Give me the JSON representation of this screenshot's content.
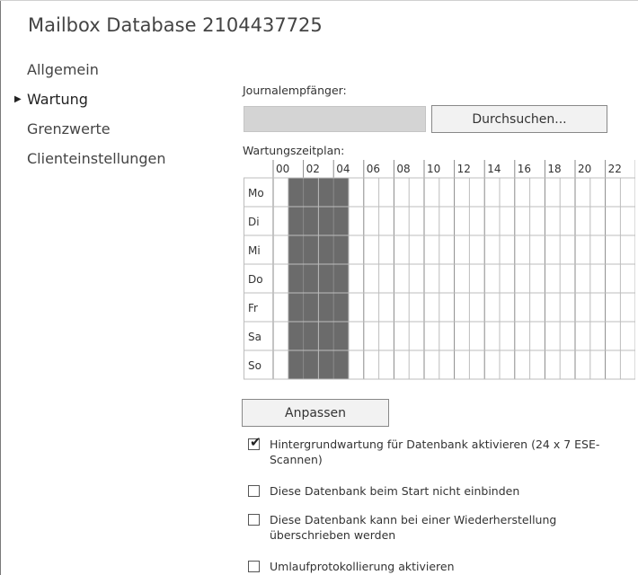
{
  "title": "Mailbox Database 2104437725",
  "nav": {
    "items": [
      {
        "label": "Allgemein",
        "selected": false
      },
      {
        "label": "Wartung",
        "selected": true
      },
      {
        "label": "Grenzwerte",
        "selected": false
      },
      {
        "label": "Clienteinstellungen",
        "selected": false
      }
    ]
  },
  "journal": {
    "label": "Journalempfänger:",
    "value": "",
    "browse_label": "Durchsuchen..."
  },
  "schedule": {
    "label": "Wartungszeitplan:",
    "hour_labels": [
      "00",
      "02",
      "04",
      "06",
      "08",
      "10",
      "12",
      "14",
      "16",
      "18",
      "20",
      "22"
    ],
    "days": [
      "Mo",
      "Di",
      "Mi",
      "Do",
      "Fr",
      "Sa",
      "So"
    ],
    "active_from_hour": 1,
    "active_to_hour": 5,
    "active_color": "#6b6b6b",
    "grid_color": "#bdbdbd"
  },
  "customize_label": "Anpassen",
  "checkboxes": [
    {
      "name": "background-maintenance-checkbox",
      "checked": true,
      "label": "Hintergrundwartung für Datenbank aktivieren (24 x 7 ESE-Scannen)"
    },
    {
      "name": "no-mount-on-startup-checkbox",
      "checked": false,
      "label": "Diese Datenbank beim Start nicht einbinden"
    },
    {
      "name": "overwrite-on-restore-checkbox",
      "checked": false,
      "label": "Diese Datenbank kann bei einer Wiederherstellung überschrieben werden"
    },
    {
      "name": "circular-logging-checkbox",
      "checked": false,
      "label": "Umlaufprotokollierung aktivieren"
    }
  ]
}
